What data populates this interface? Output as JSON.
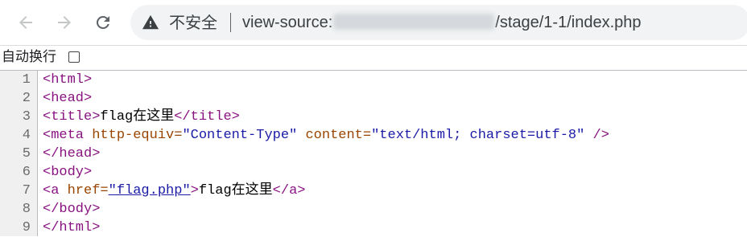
{
  "browser": {
    "security_label": "不安全",
    "url_prefix": "view-source:",
    "url_suffix": "/stage/1-1/index.php",
    "icons": {
      "back": "back-arrow-icon",
      "forward": "forward-arrow-icon",
      "reload": "reload-icon",
      "warning": "warning-triangle-icon"
    }
  },
  "wrap": {
    "label": "自动换行",
    "checked": false
  },
  "source": {
    "line_numbers": [
      "1",
      "2",
      "3",
      "4",
      "5",
      "6",
      "7",
      "8",
      "9"
    ],
    "l1": "<html>",
    "l2": "<head>",
    "l3": {
      "open": "<title>",
      "text": "flag在这里",
      "close": "</title>"
    },
    "l4": {
      "open": "<meta ",
      "attr1": "http-equiv=",
      "val1": "\"Content-Type\"",
      "attr2": " content=",
      "val2": "\"text/html; charset=utf-8\"",
      "close": " />"
    },
    "l5": "</head>",
    "l6": "<body>",
    "l7": {
      "open": "<a ",
      "attr": "href=",
      "href": "\"flag.php\"",
      "gt": ">",
      "text": "flag在这里",
      "close": "</a>"
    },
    "l8": "</body>",
    "l9": "</html>"
  }
}
